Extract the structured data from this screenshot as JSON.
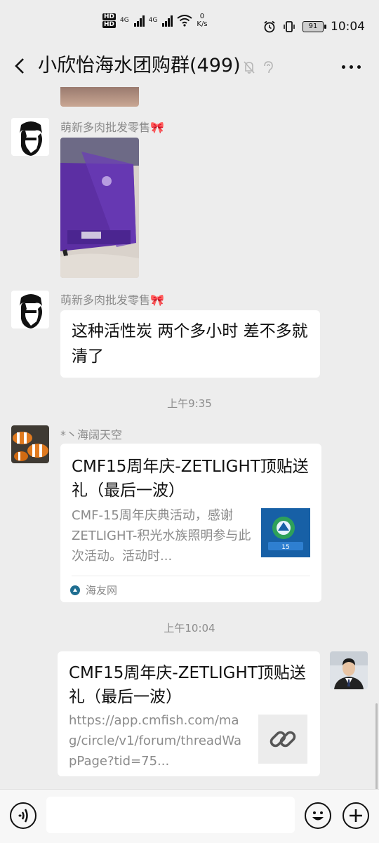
{
  "status_bar": {
    "hd1": "HD",
    "hd2": "HD",
    "net1": "4G",
    "net2": "4G",
    "speed_value": "0",
    "speed_unit": "K/s",
    "battery": "91",
    "time": "10:04"
  },
  "header": {
    "title": "小欣怡海水团购群(499)"
  },
  "messages": [
    {
      "sender": "萌新多肉批发零售🎀",
      "type": "image"
    },
    {
      "sender": "萌新多肉批发零售🎀",
      "type": "text",
      "text": "这种活性炭 两个多小时 差不多就清了"
    },
    {
      "type": "time",
      "text": "上午9:35"
    },
    {
      "sender": "*丶海阔天空",
      "type": "link_card",
      "title": "CMF15周年庆-ZETLIGHT顶贴送礼（最后一波）",
      "description": "CMF-15周年庆典活动，感谢ZETLIGHT-积光水族照明参与此次活动。活动时...",
      "source": "海友网"
    },
    {
      "type": "time",
      "text": "上午10:04"
    },
    {
      "sender": "me",
      "type": "link_card",
      "title": "CMF15周年庆-ZETLIGHT顶贴送礼（最后一波）",
      "url": "https://app.cmfish.com/mag/circle/v1/forum/threadWapPage?tid=75..."
    }
  ],
  "input_bar": {
    "placeholder": ""
  },
  "colors": {
    "background": "#ededed",
    "bubble": "#ffffff",
    "muted_text": "#8b8b8b"
  }
}
